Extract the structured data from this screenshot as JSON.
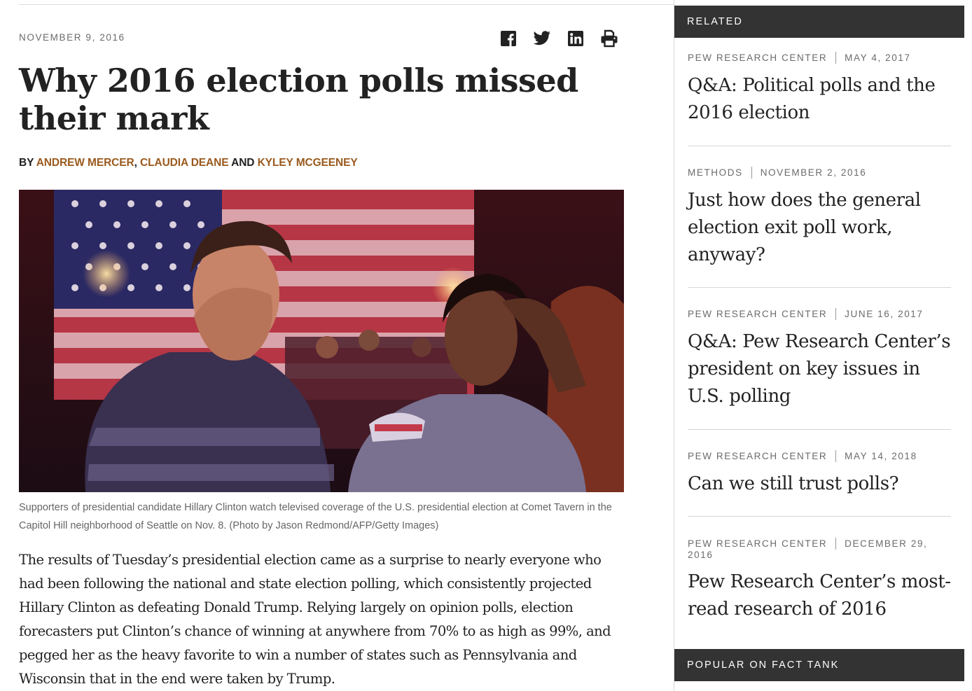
{
  "article": {
    "date": "NOVEMBER 9, 2016",
    "headline": "Why 2016 election polls missed their mark",
    "byline": {
      "prefix": "BY ",
      "authors": [
        "ANDREW MERCER",
        "CLAUDIA DEANE",
        "KYLEY MCGEENEY"
      ],
      "sep_comma": ", ",
      "sep_and": " AND "
    },
    "share_icons": [
      "facebook-icon",
      "twitter-icon",
      "linkedin-icon",
      "print-icon"
    ],
    "photo_caption": "Supporters of presidential candidate Hillary Clinton watch televised coverage of the U.S. presidential election at Comet Tavern in the Capitol Hill neighborhood of Seattle on Nov. 8. (Photo by Jason Redmond/AFP/Getty Images)",
    "body": "The results of Tuesday’s presidential election came as a surprise to nearly everyone who had been following the national and state election polling, which consistently projected Hillary Clinton as defeating Donald Trump. Relying largely on opinion polls, election forecasters put Clinton’s chance of winning at anywhere from 70% to as high as 99%, and pegged her as the heavy favorite to win a number of states such as Pennsylvania and Wisconsin that in the end were taken by Trump."
  },
  "sidebar": {
    "related_heading": "RELATED",
    "popular_heading": "POPULAR ON FACT TANK",
    "items": [
      {
        "category": "PEW RESEARCH CENTER",
        "date": "MAY 4, 2017",
        "title": "Q&A: Political polls and the 2016 election"
      },
      {
        "category": "METHODS",
        "date": "NOVEMBER 2, 2016",
        "title": "Just how does the general election exit poll work, anyway?"
      },
      {
        "category": "PEW RESEARCH CENTER",
        "date": "JUNE 16, 2017",
        "title": "Q&A: Pew Research Center’s president on key issues in U.S. polling"
      },
      {
        "category": "PEW RESEARCH CENTER",
        "date": "MAY 14, 2018",
        "title": "Can we still trust polls?"
      },
      {
        "category": "PEW RESEARCH CENTER",
        "date": "DECEMBER 29, 2016",
        "title": "Pew Research Center’s most-read research of 2016"
      }
    ]
  },
  "colors": {
    "author_link": "#9a5a1e",
    "sidebar_header_bg": "#333333",
    "text": "#222222",
    "meta": "#6b6b6b"
  }
}
